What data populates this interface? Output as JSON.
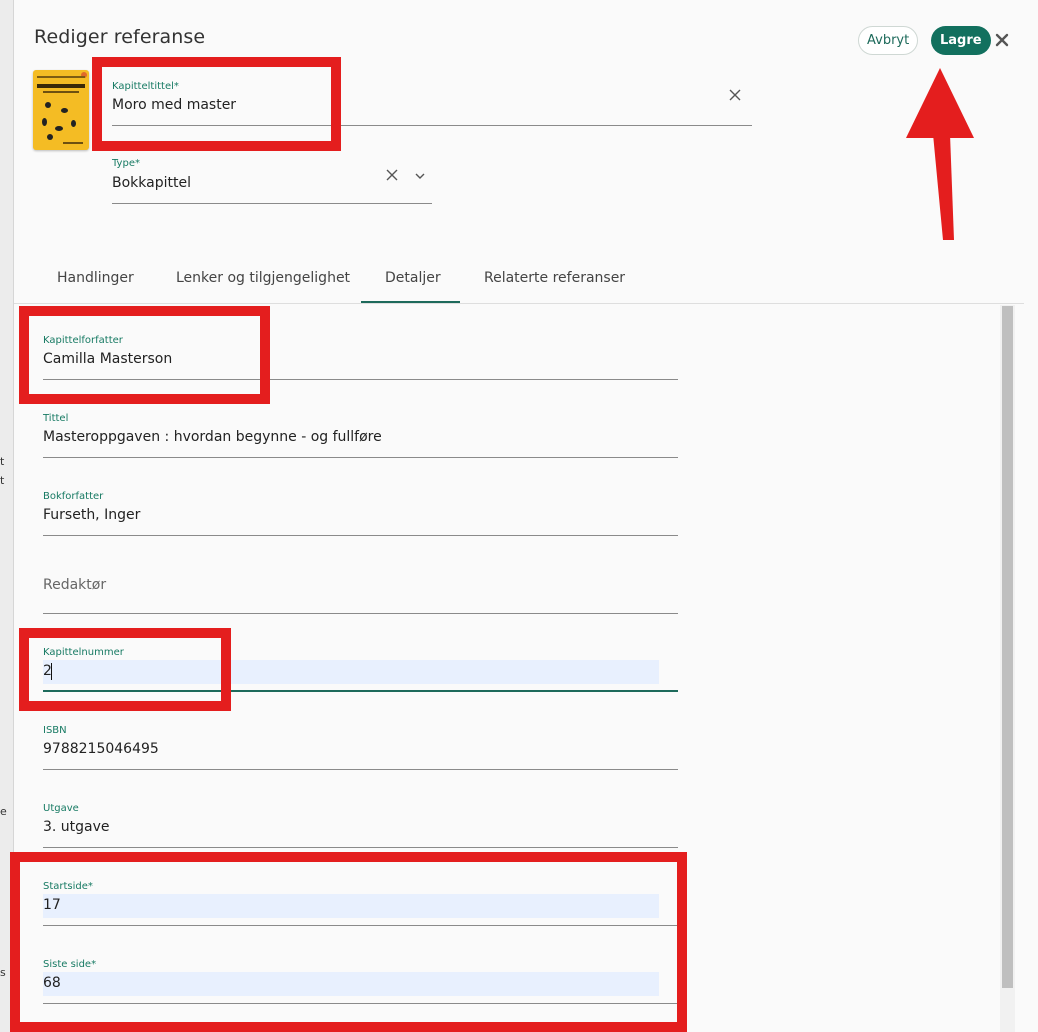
{
  "dialog": {
    "title": "Rediger referanse",
    "cancel_label": "Avbryt",
    "save_label": "Lagre"
  },
  "header_fields": {
    "chapter_title": {
      "label": "Kapitteltittel*",
      "value": "Moro med master"
    },
    "type": {
      "label": "Type*",
      "value": "Bokkapittel"
    }
  },
  "cover": {
    "alt": "MASTEROPPGAVEN",
    "color": "#f4bc24"
  },
  "tabs": [
    {
      "label": "Handlinger"
    },
    {
      "label": "Lenker og tilgjengelighet"
    },
    {
      "label": "Detaljer"
    },
    {
      "label": "Relaterte referanser"
    }
  ],
  "active_tab": "Detaljer",
  "details": {
    "chapter_author": {
      "label": "Kapittelforfatter",
      "value": "Camilla Masterson"
    },
    "title": {
      "label": "Tittel",
      "value": "Masteroppgaven : hvordan begynne - og fullføre"
    },
    "book_author": {
      "label": "Bokforfatter",
      "value": "Furseth, Inger"
    },
    "editor": {
      "placeholder": "Redaktør"
    },
    "chapter_number": {
      "label": "Kapittelnummer",
      "value": "2"
    },
    "isbn": {
      "label": "ISBN",
      "value": "9788215046495"
    },
    "edition": {
      "label": "Utgave",
      "value": "3. utgave"
    },
    "start_page": {
      "label": "Startside*",
      "value": "17"
    },
    "last_page": {
      "label": "Siste side*",
      "value": "68"
    }
  },
  "background_fragments": [
    "t",
    "t",
    "e",
    "s"
  ],
  "colors": {
    "accent": "#12705e",
    "label": "#177a63",
    "autofill": "#e8f0fe",
    "annotation": "#e41e1e"
  }
}
